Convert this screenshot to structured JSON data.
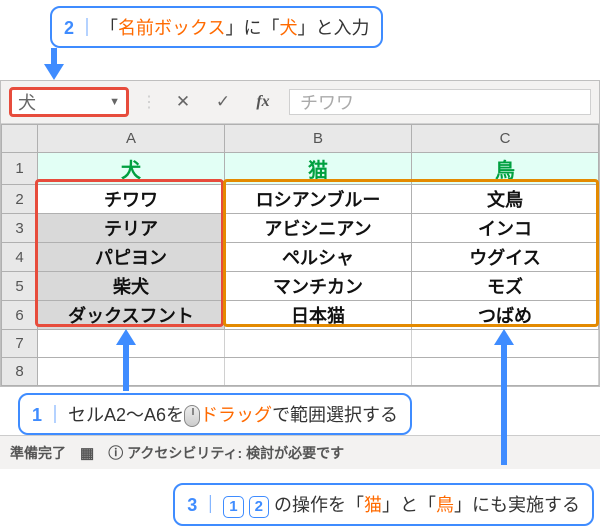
{
  "callouts": {
    "c2": {
      "n": "2",
      "t1": "「",
      "name": "名前ボックス",
      "t2": "」に「",
      "val": "犬",
      "t3": "」と入力"
    },
    "c1": {
      "n": "1",
      "t1": "セルA2～A6を",
      "drag": "ドラッグ",
      "t2": "で範囲選択する"
    },
    "c3": {
      "n": "3",
      "s1": "1",
      "s2": "2",
      "t1": "の操作を「",
      "cat": "猫",
      "t2": "」と「",
      "bird": "鳥",
      "t3": "」にも実施する"
    }
  },
  "formula_bar": {
    "name_box_value": "犬",
    "formula_value": "チワワ"
  },
  "columns": [
    "A",
    "B",
    "C"
  ],
  "row_nums": [
    "1",
    "2",
    "3",
    "4",
    "5",
    "6",
    "7",
    "8"
  ],
  "headers": [
    "犬",
    "猫",
    "鳥"
  ],
  "rows": [
    [
      "チワワ",
      "ロシアンブルー",
      "文鳥"
    ],
    [
      "テリア",
      "アビシニアン",
      "インコ"
    ],
    [
      "パピヨン",
      "ペルシャ",
      "ウグイス"
    ],
    [
      "柴犬",
      "マンチカン",
      "モズ"
    ],
    [
      "ダックスフント",
      "日本猫",
      "つばめ"
    ]
  ],
  "status": {
    "ready": "準備完了",
    "acc": "アクセシビリティ: 検討が必要です"
  }
}
